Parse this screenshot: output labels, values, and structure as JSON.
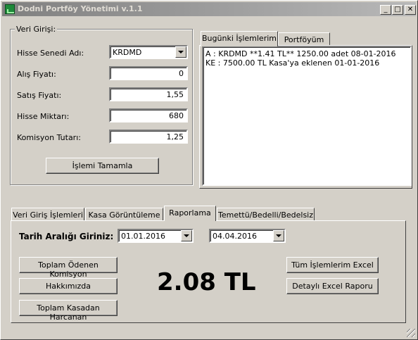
{
  "window": {
    "title": "Dodni Portföy Yönetimi v.1.1",
    "caption_buttons": {
      "minimize": "_",
      "maximize": "□",
      "close": "✕"
    }
  },
  "entry": {
    "legend": "Veri Girişi:",
    "stock_label": "Hisse Senedi Adı:",
    "stock_value": "KRDMD",
    "buy_label": "Alış Fiyatı:",
    "buy_value": "0",
    "sell_label": "Satış Fiyatı:",
    "sell_value": "1,55",
    "qty_label": "Hisse Miktarı:",
    "qty_value": "680",
    "commission_label": "Komisyon Tutarı:",
    "commission_value": "1,25",
    "complete_button": "İşlemi Tamamla"
  },
  "right_tabs": {
    "tabs": [
      "Bugünki İşlemlerim",
      "Portföyüm"
    ],
    "lines": [
      "A : KRDMD  **1.41 TL** 1250.00 adet  08-01-2016",
      "KE :  7500.00 TL Kasa'ya eklenen  01-01-2016"
    ]
  },
  "bottom_tabs": {
    "tabs": [
      "Veri Giriş İşlemleri",
      "Kasa Görüntüleme",
      "Raporlama",
      "Temettü/Bedelli/Bedelsiz"
    ],
    "date_label": "Tarih Aralığı Giriniz:",
    "date_from": "01.01.2016",
    "date_to": "04.04.2016",
    "btn_commission": "Toplam Ödenen Komisyon",
    "btn_about": "Hakkımızda",
    "btn_spent": "Toplam Kasadan Harcanan",
    "btn_all_excel": "Tüm İşlemlerim Excel",
    "btn_detail_excel": "Detaylı Excel Raporu",
    "result": "2.08 TL"
  }
}
